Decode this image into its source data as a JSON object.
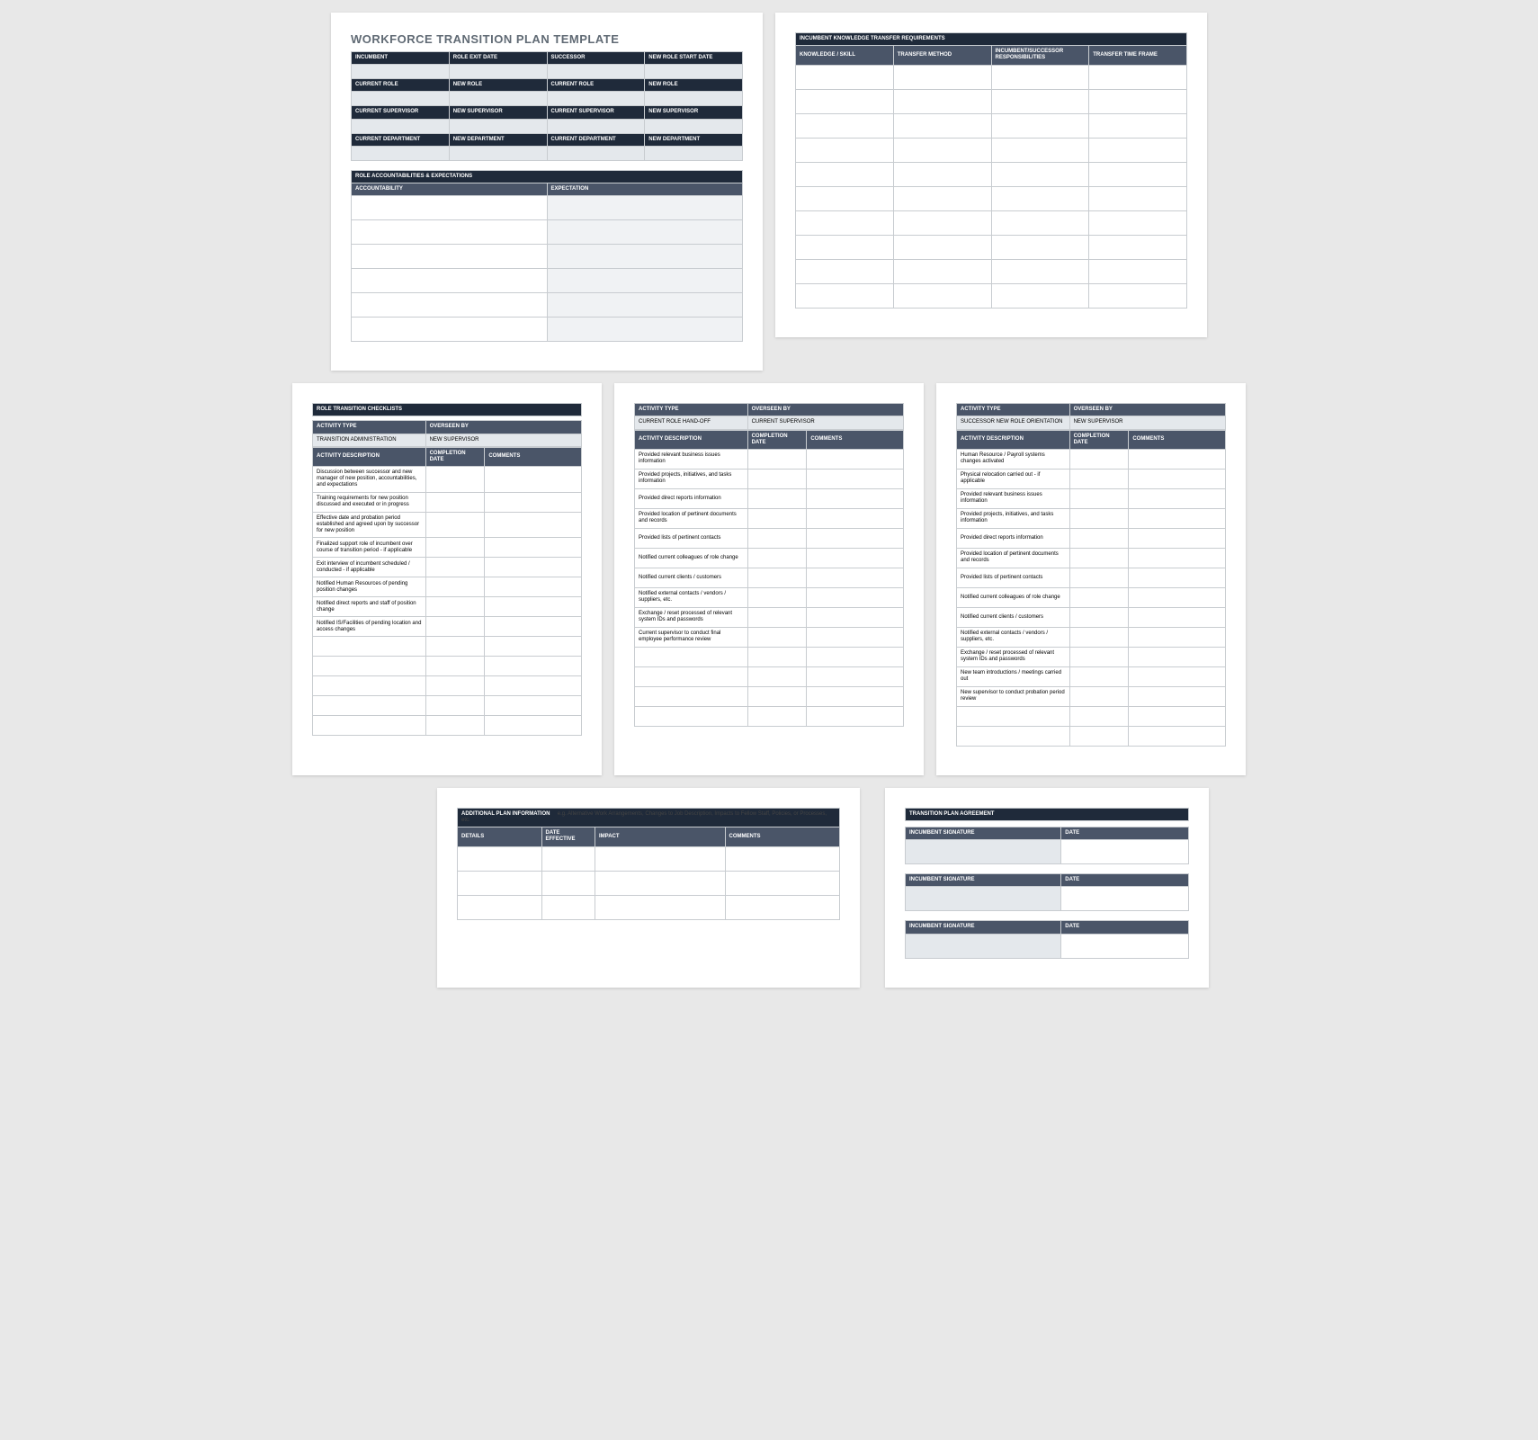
{
  "title": "WORKFORCE TRANSITION PLAN TEMPLATE",
  "page1": {
    "basic_headers": [
      "INCUMBENT",
      "ROLE EXIT DATE",
      "SUCCESSOR",
      "NEW ROLE START DATE"
    ],
    "role_headers": [
      "CURRENT ROLE",
      "NEW ROLE",
      "CURRENT ROLE",
      "NEW ROLE"
    ],
    "sup_headers": [
      "CURRENT SUPERVISOR",
      "NEW SUPERVISOR",
      "CURRENT SUPERVISOR",
      "NEW SUPERVISOR"
    ],
    "dept_headers": [
      "CURRENT DEPARTMENT",
      "NEW DEPARTMENT",
      "CURRENT DEPARTMENT",
      "NEW DEPARTMENT"
    ],
    "acct_title": "ROLE ACCOUNTABILITIES & EXPECTATIONS",
    "acct_headers": [
      "ACCOUNTABILITY",
      "EXPECTATION"
    ]
  },
  "page2": {
    "title": "INCUMBENT KNOWLEDGE TRANSFER REQUIREMENTS",
    "headers": [
      "KNOWLEDGE / SKILL",
      "TRANSFER METHOD",
      "INCUMBENT/SUCCESSOR RESPONSIBILITIES",
      "TRANSFER TIME FRAME"
    ]
  },
  "page3": {
    "title": "ROLE TRANSITION CHECKLISTS",
    "row1": [
      "ACTIVITY TYPE",
      "OVERSEEN BY"
    ],
    "row2": [
      "TRANSITION ADMINISTRATION",
      "NEW SUPERVISOR"
    ],
    "headers": [
      "ACTIVITY DESCRIPTION",
      "COMPLETION DATE",
      "COMMENTS"
    ],
    "items": [
      "Discussion between successor and new manager of new position, accountabilities, and expectations",
      "Training requirements for new position discussed and executed or in progress",
      "Effective date and probation period established and agreed upon by successor for new position",
      "Finalized support role of incumbent over course of transition period - if applicable",
      "Exit interview of incumbent scheduled / conducted - if applicable",
      "Notified Human Resources of pending position changes",
      "Notified direct reports and staff of position change",
      "Notified IS/Facilities of pending location and access changes"
    ]
  },
  "page4": {
    "row1": [
      "ACTIVITY TYPE",
      "OVERSEEN BY"
    ],
    "row2": [
      "CURRENT ROLE HAND-OFF",
      "CURRENT SUPERVISOR"
    ],
    "headers": [
      "ACTIVITY DESCRIPTION",
      "COMPLETION DATE",
      "COMMENTS"
    ],
    "items": [
      "Provided relevant business issues information",
      "Provided projects, initiatives, and tasks information",
      "Provided direct reports information",
      "Provided location of pertinent documents and records",
      "Provided lists of pertinent contacts",
      "Notified current colleagues of role change",
      "Notified current clients / customers",
      "Notified external contacts / vendors / suppliers, etc.",
      "Exchange / reset processed of relevant system IDs and passwords",
      "Current supervisor to conduct final employee performance review"
    ]
  },
  "page5": {
    "row1": [
      "ACTIVITY TYPE",
      "OVERSEEN BY"
    ],
    "row2": [
      "SUCCESSOR NEW ROLE ORIENTATION",
      "NEW SUPERVISOR"
    ],
    "headers": [
      "ACTIVITY DESCRIPTION",
      "COMPLETION DATE",
      "COMMENTS"
    ],
    "items": [
      "Human Resource / Payroll systems changes activated",
      "Physical relocation carried out - if applicable",
      "Provided relevant business issues information",
      "Provided projects, initiatives, and tasks information",
      "Provided direct reports information",
      "Provided location of pertinent documents and records",
      "Provided lists of pertinent contacts",
      "Notified current colleagues of role change",
      "Notified current clients / customers",
      "Notified external contacts / vendors / suppliers, etc.",
      "Exchange / reset processed of relevant system IDs and passwords",
      "New team introductions / meetings carried out",
      "New supervisor to conduct probation period review"
    ]
  },
  "page6": {
    "title": "ADDITIONAL PLAN INFORMATION",
    "hint": "e.g. Alternative Work Arrangements, Changes to Job Description, Impacts to Fellow Staff, Policies, or Processes, etc.",
    "headers": [
      "DETAILS",
      "DATE EFFECTIVE",
      "IMPACT",
      "COMMENTS"
    ]
  },
  "page7": {
    "title": "TRANSITION PLAN AGREEMENT",
    "sig_label": "INCUMBENT SIGNATURE",
    "date_label": "DATE"
  }
}
